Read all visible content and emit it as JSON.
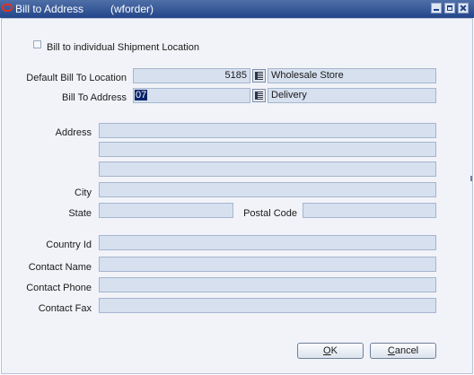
{
  "window": {
    "title": "Bill to Address",
    "subtitle": "(wforder)"
  },
  "options": {
    "bill_individual_label": "Bill to individual Shipment Location",
    "bill_individual_checked": false
  },
  "fields": {
    "default_bill_location": {
      "label": "Default Bill To Location",
      "code": "5185",
      "description": "Wholesale Store"
    },
    "bill_to_address": {
      "label": "Bill To Address",
      "code": "07",
      "description": "Delivery"
    },
    "address": {
      "label": "Address",
      "line1": "",
      "line2": "",
      "line3": ""
    },
    "city": {
      "label": "City",
      "value": ""
    },
    "state": {
      "label": "State",
      "value": ""
    },
    "postal_code": {
      "label": "Postal Code",
      "value": ""
    },
    "country_id": {
      "label": "Country Id",
      "value": ""
    },
    "contact_name": {
      "label": "Contact Name",
      "value": ""
    },
    "contact_phone": {
      "label": "Contact Phone",
      "value": ""
    },
    "contact_fax": {
      "label": "Contact Fax",
      "value": ""
    }
  },
  "buttons": {
    "ok": {
      "mnemonic": "O",
      "rest": "K"
    },
    "cancel": {
      "mnemonic": "C",
      "rest": "ancel"
    }
  },
  "icons": {
    "app": "oracle-logo-icon",
    "lov": "list-of-values-icon",
    "minimize": "minimize-icon",
    "maximize": "maximize-icon",
    "close": "close-icon"
  },
  "colors": {
    "titlebar": "#23468a",
    "field_bg": "#d6e0ef",
    "panel_bg": "#f1f3f8",
    "selection": "#0a246a"
  }
}
